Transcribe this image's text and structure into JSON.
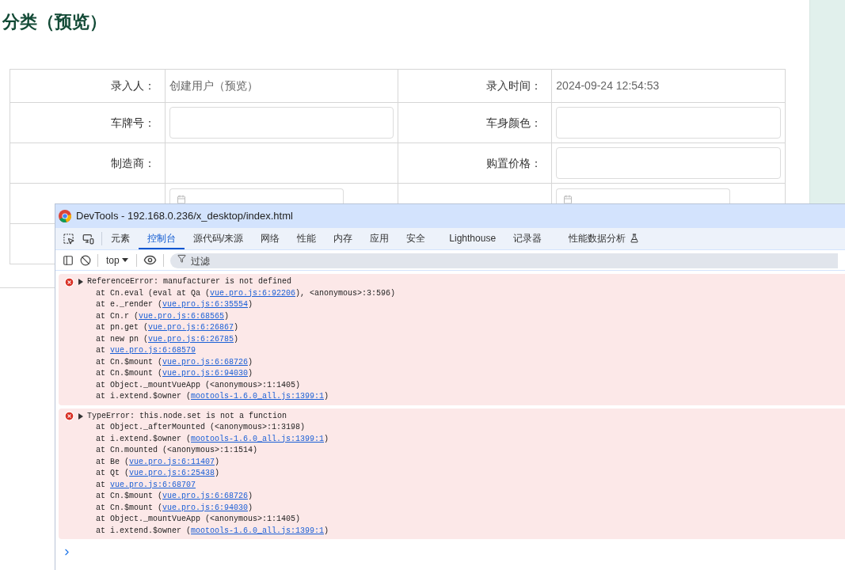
{
  "page": {
    "title": "分类（预览）",
    "form_rows": [
      {
        "cells": [
          {
            "label": "录入人：",
            "kind": "text",
            "value": "创建用户（预览）"
          },
          {
            "label": "录入时间：",
            "kind": "text",
            "value": "2024-09-24 12:54:53"
          }
        ]
      },
      {
        "cells": [
          {
            "label": "车牌号：",
            "kind": "input"
          },
          {
            "label": "车身颜色：",
            "kind": "input"
          }
        ]
      },
      {
        "cells": [
          {
            "label": "制造商：",
            "kind": "empty"
          },
          {
            "label": "购置价格：",
            "kind": "input"
          }
        ]
      },
      {
        "cells": [
          {
            "kind": "date"
          },
          {
            "kind": "date"
          }
        ]
      },
      {
        "cells": [
          {
            "kind": "blank"
          },
          {
            "kind": "covered"
          }
        ]
      }
    ]
  },
  "devtools": {
    "title": "DevTools - 192.168.0.236/x_desktop/index.html",
    "tabs": [
      {
        "label": "元素",
        "selected": false
      },
      {
        "label": "控制台",
        "selected": true
      },
      {
        "label": "源代码/来源",
        "selected": false
      },
      {
        "label": "网络",
        "selected": false
      },
      {
        "label": "性能",
        "selected": false
      },
      {
        "label": "内存",
        "selected": false
      },
      {
        "label": "应用",
        "selected": false
      },
      {
        "label": "安全",
        "selected": false
      },
      {
        "label": "Lighthouse",
        "selected": false
      },
      {
        "label": "记录器",
        "selected": false
      },
      {
        "label": "性能数据分析",
        "selected": false,
        "experimental": true
      }
    ],
    "context": "top",
    "filter_placeholder": "过滤",
    "messages": [
      {
        "message": "ReferenceError: manufacturer is not defined",
        "stack": [
          {
            "text": "at Cn.eval (eval at Qa (",
            "link": "vue.pro.js:6:92206",
            "after": "), <anonymous>:3:596)"
          },
          {
            "text": "at e._render (",
            "link": "vue.pro.js:6:35554",
            "after": ")"
          },
          {
            "text": "at Cn.r (",
            "link": "vue.pro.js:6:68565",
            "after": ")"
          },
          {
            "text": "at pn.get (",
            "link": "vue.pro.js:6:26867",
            "after": ")"
          },
          {
            "text": "at new pn (",
            "link": "vue.pro.js:6:26785",
            "after": ")"
          },
          {
            "text": "at ",
            "link": "vue.pro.js:6:68579"
          },
          {
            "text": "at Cn.$mount (",
            "link": "vue.pro.js:6:68726",
            "after": ")"
          },
          {
            "text": "at Cn.$mount (",
            "link": "vue.pro.js:6:94030",
            "after": ")"
          },
          {
            "text": "at Object._mountVueApp (<anonymous>:1:1405)"
          },
          {
            "text": "at i.extend.$owner (",
            "link": "mootools-1.6.0_all.js:1399:1",
            "after": ")"
          }
        ]
      },
      {
        "message": "TypeError: this.node.set is not a function",
        "stack": [
          {
            "text": "at Object._afterMounted (<anonymous>:1:3198)"
          },
          {
            "text": "at i.extend.$owner (",
            "link": "mootools-1.6.0_all.js:1399:1",
            "after": ")"
          },
          {
            "text": "at Cn.mounted (<anonymous>:1:1514)"
          },
          {
            "text": "at Be (",
            "link": "vue.pro.js:6:11407",
            "after": ")"
          },
          {
            "text": "at Qt (",
            "link": "vue.pro.js:6:25438",
            "after": ")"
          },
          {
            "text": "at ",
            "link": "vue.pro.js:6:68707"
          },
          {
            "text": "at Cn.$mount (",
            "link": "vue.pro.js:6:68726",
            "after": ")"
          },
          {
            "text": "at Cn.$mount (",
            "link": "vue.pro.js:6:94030",
            "after": ")"
          },
          {
            "text": "at Object._mountVueApp (<anonymous>:1:1405)"
          },
          {
            "text": "at i.extend.$owner (",
            "link": "mootools-1.6.0_all.js:1399:1",
            "after": ")"
          }
        ]
      }
    ]
  }
}
